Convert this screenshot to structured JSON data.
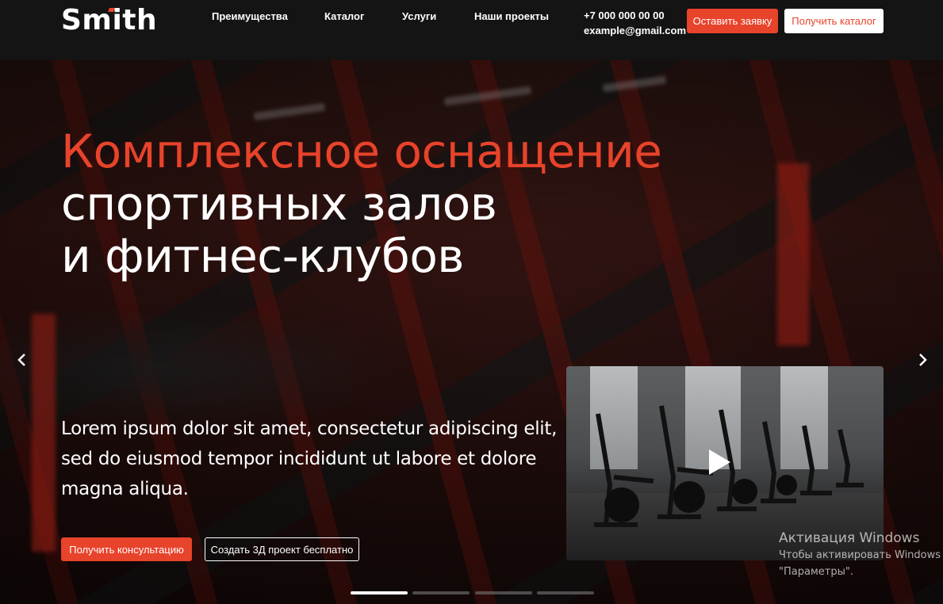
{
  "header": {
    "logo": "Smith",
    "nav": [
      "Преимущества",
      "Каталог",
      "Услуги",
      "Наши проекты"
    ],
    "phone": "+7 000 000 00 00",
    "email": "example@gmail.com",
    "request_button": "Оставить заявку",
    "catalog_button": "Получить каталог"
  },
  "hero": {
    "title_line1": "Комплексное оснащение",
    "title_line2": "спортивных залов",
    "title_line3": "и фитнес-клубов",
    "lead": "Lorem ipsum dolor sit amet, consectetur adipiscing elit, sed do eiusmod tempor incididunt ut labore et dolore magna aliqua.",
    "consult_button": "Получить консультацию",
    "project_button": "Создать 3Д проект бесплатно",
    "slides_total": 4,
    "slide_active": 1
  },
  "windows_activation": {
    "title": "Активация Windows",
    "line1": "Чтобы активировать Windows",
    "line2": "\"Параметры\"."
  },
  "colors": {
    "accent": "#e8432b",
    "header_bg": "#141414"
  },
  "icons": [
    "arrow-left-icon",
    "arrow-right-icon",
    "play-icon"
  ]
}
